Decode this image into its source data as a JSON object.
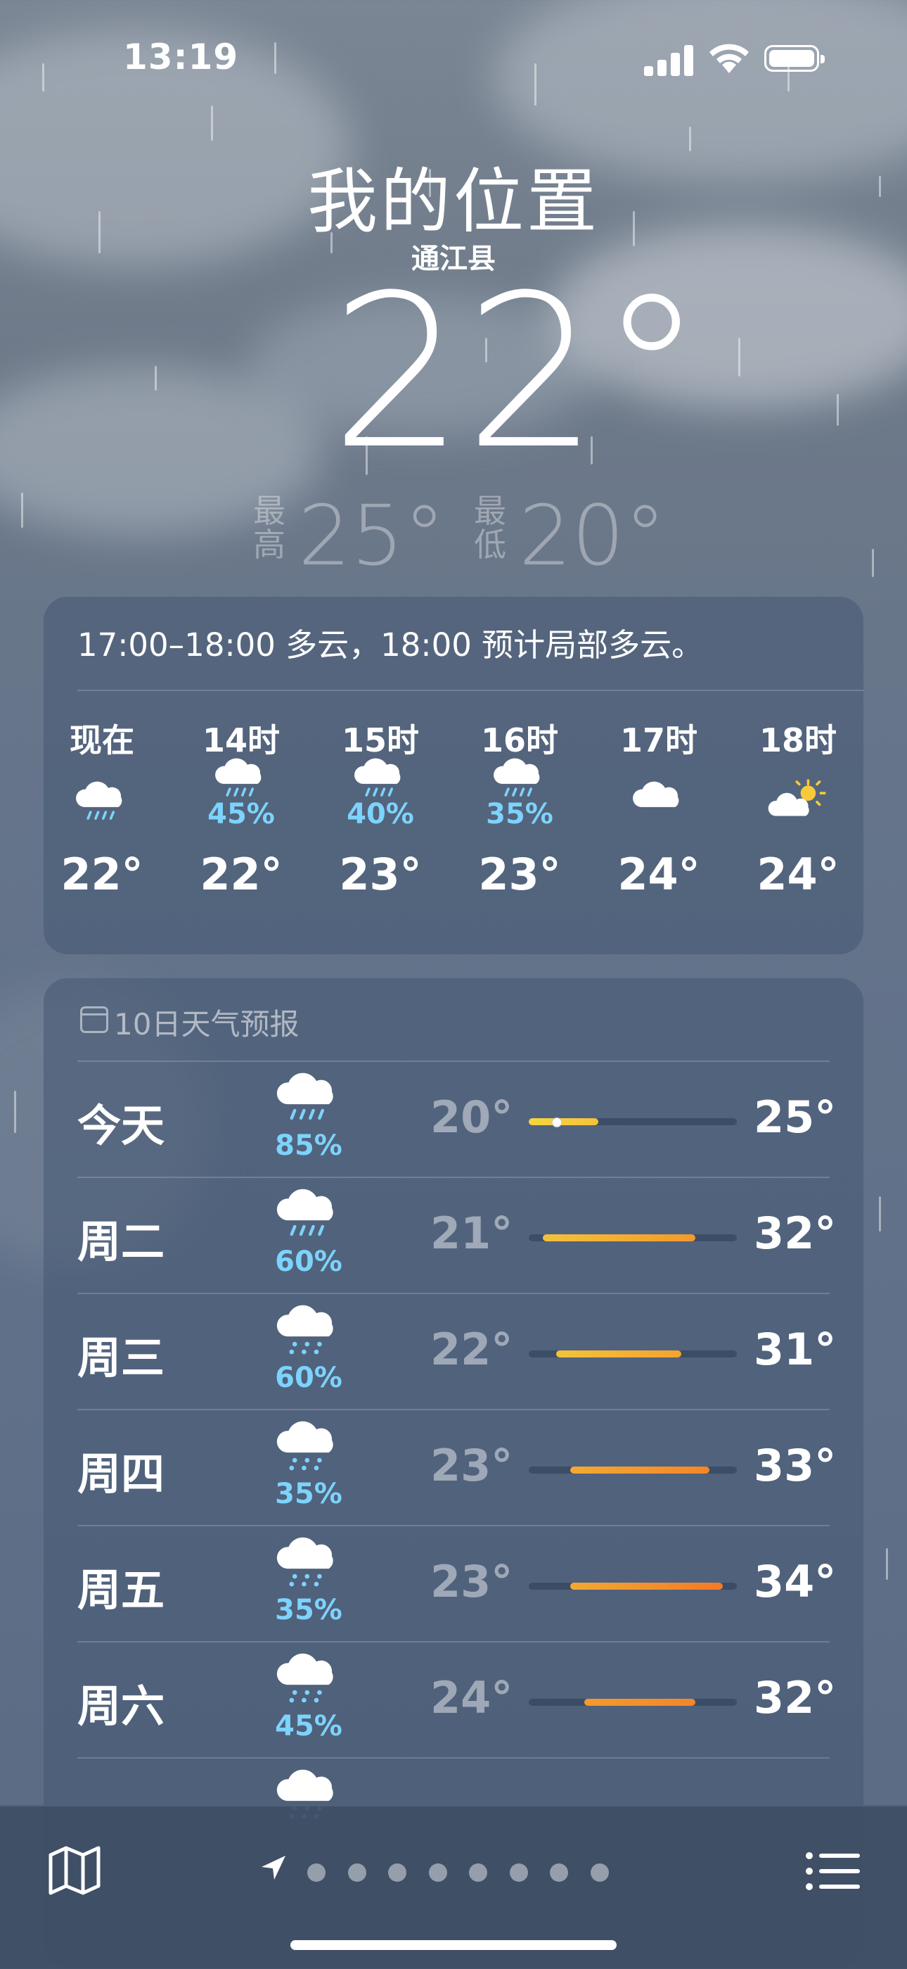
{
  "status": {
    "time": "13:19"
  },
  "location": {
    "title": "我的位置",
    "subtitle": "通江县",
    "temp": "22°",
    "high_label": "最\n高",
    "high": "25°",
    "low_label": "最\n低",
    "low": "20°"
  },
  "hourly": {
    "summary": "17:00–18:00 多云，18:00 预计局部多云。",
    "items": [
      {
        "label": "现在",
        "icon": "cloud-rain-icon",
        "pct": "",
        "temp": "22°"
      },
      {
        "label": "14时",
        "icon": "cloud-rain-icon",
        "pct": "45%",
        "temp": "22°"
      },
      {
        "label": "15时",
        "icon": "cloud-rain-icon",
        "pct": "40%",
        "temp": "23°"
      },
      {
        "label": "16时",
        "icon": "cloud-rain-icon",
        "pct": "35%",
        "temp": "23°"
      },
      {
        "label": "17时",
        "icon": "cloud-icon",
        "pct": "",
        "temp": "24°"
      },
      {
        "label": "18时",
        "icon": "cloud-sun-icon",
        "pct": "",
        "temp": "24°"
      }
    ]
  },
  "forecast": {
    "title": "10日天气预报",
    "range": [
      20,
      35
    ],
    "days": [
      {
        "day": "今天",
        "icon": "cloud-rain-icon",
        "pct": "85%",
        "lo": "20°",
        "hi": "25°",
        "lo_v": 20,
        "hi_v": 25,
        "current_v": 22,
        "colors": [
          "#f6d73e",
          "#f5c23a"
        ]
      },
      {
        "day": "周二",
        "icon": "cloud-rain-icon",
        "pct": "60%",
        "lo": "21°",
        "hi": "32°",
        "lo_v": 21,
        "hi_v": 32,
        "colors": [
          "#f3c23a",
          "#f39a2c"
        ]
      },
      {
        "day": "周三",
        "icon": "cloud-drizzle-icon",
        "pct": "60%",
        "lo": "22°",
        "hi": "31°",
        "lo_v": 22,
        "hi_v": 31,
        "colors": [
          "#f3c23a",
          "#f4a32f"
        ]
      },
      {
        "day": "周四",
        "icon": "cloud-drizzle-icon",
        "pct": "35%",
        "lo": "23°",
        "hi": "33°",
        "lo_v": 23,
        "hi_v": 33,
        "colors": [
          "#f3a932",
          "#f48628"
        ]
      },
      {
        "day": "周五",
        "icon": "cloud-drizzle-icon",
        "pct": "35%",
        "lo": "23°",
        "hi": "34°",
        "lo_v": 23,
        "hi_v": 34,
        "colors": [
          "#f3a932",
          "#f27a28"
        ]
      },
      {
        "day": "周六",
        "icon": "cloud-drizzle-icon",
        "pct": "45%",
        "lo": "24°",
        "hi": "32°",
        "lo_v": 24,
        "hi_v": 32,
        "colors": [
          "#f39a2c",
          "#f48628"
        ]
      }
    ]
  },
  "tabbar": {
    "page_count": 8
  }
}
